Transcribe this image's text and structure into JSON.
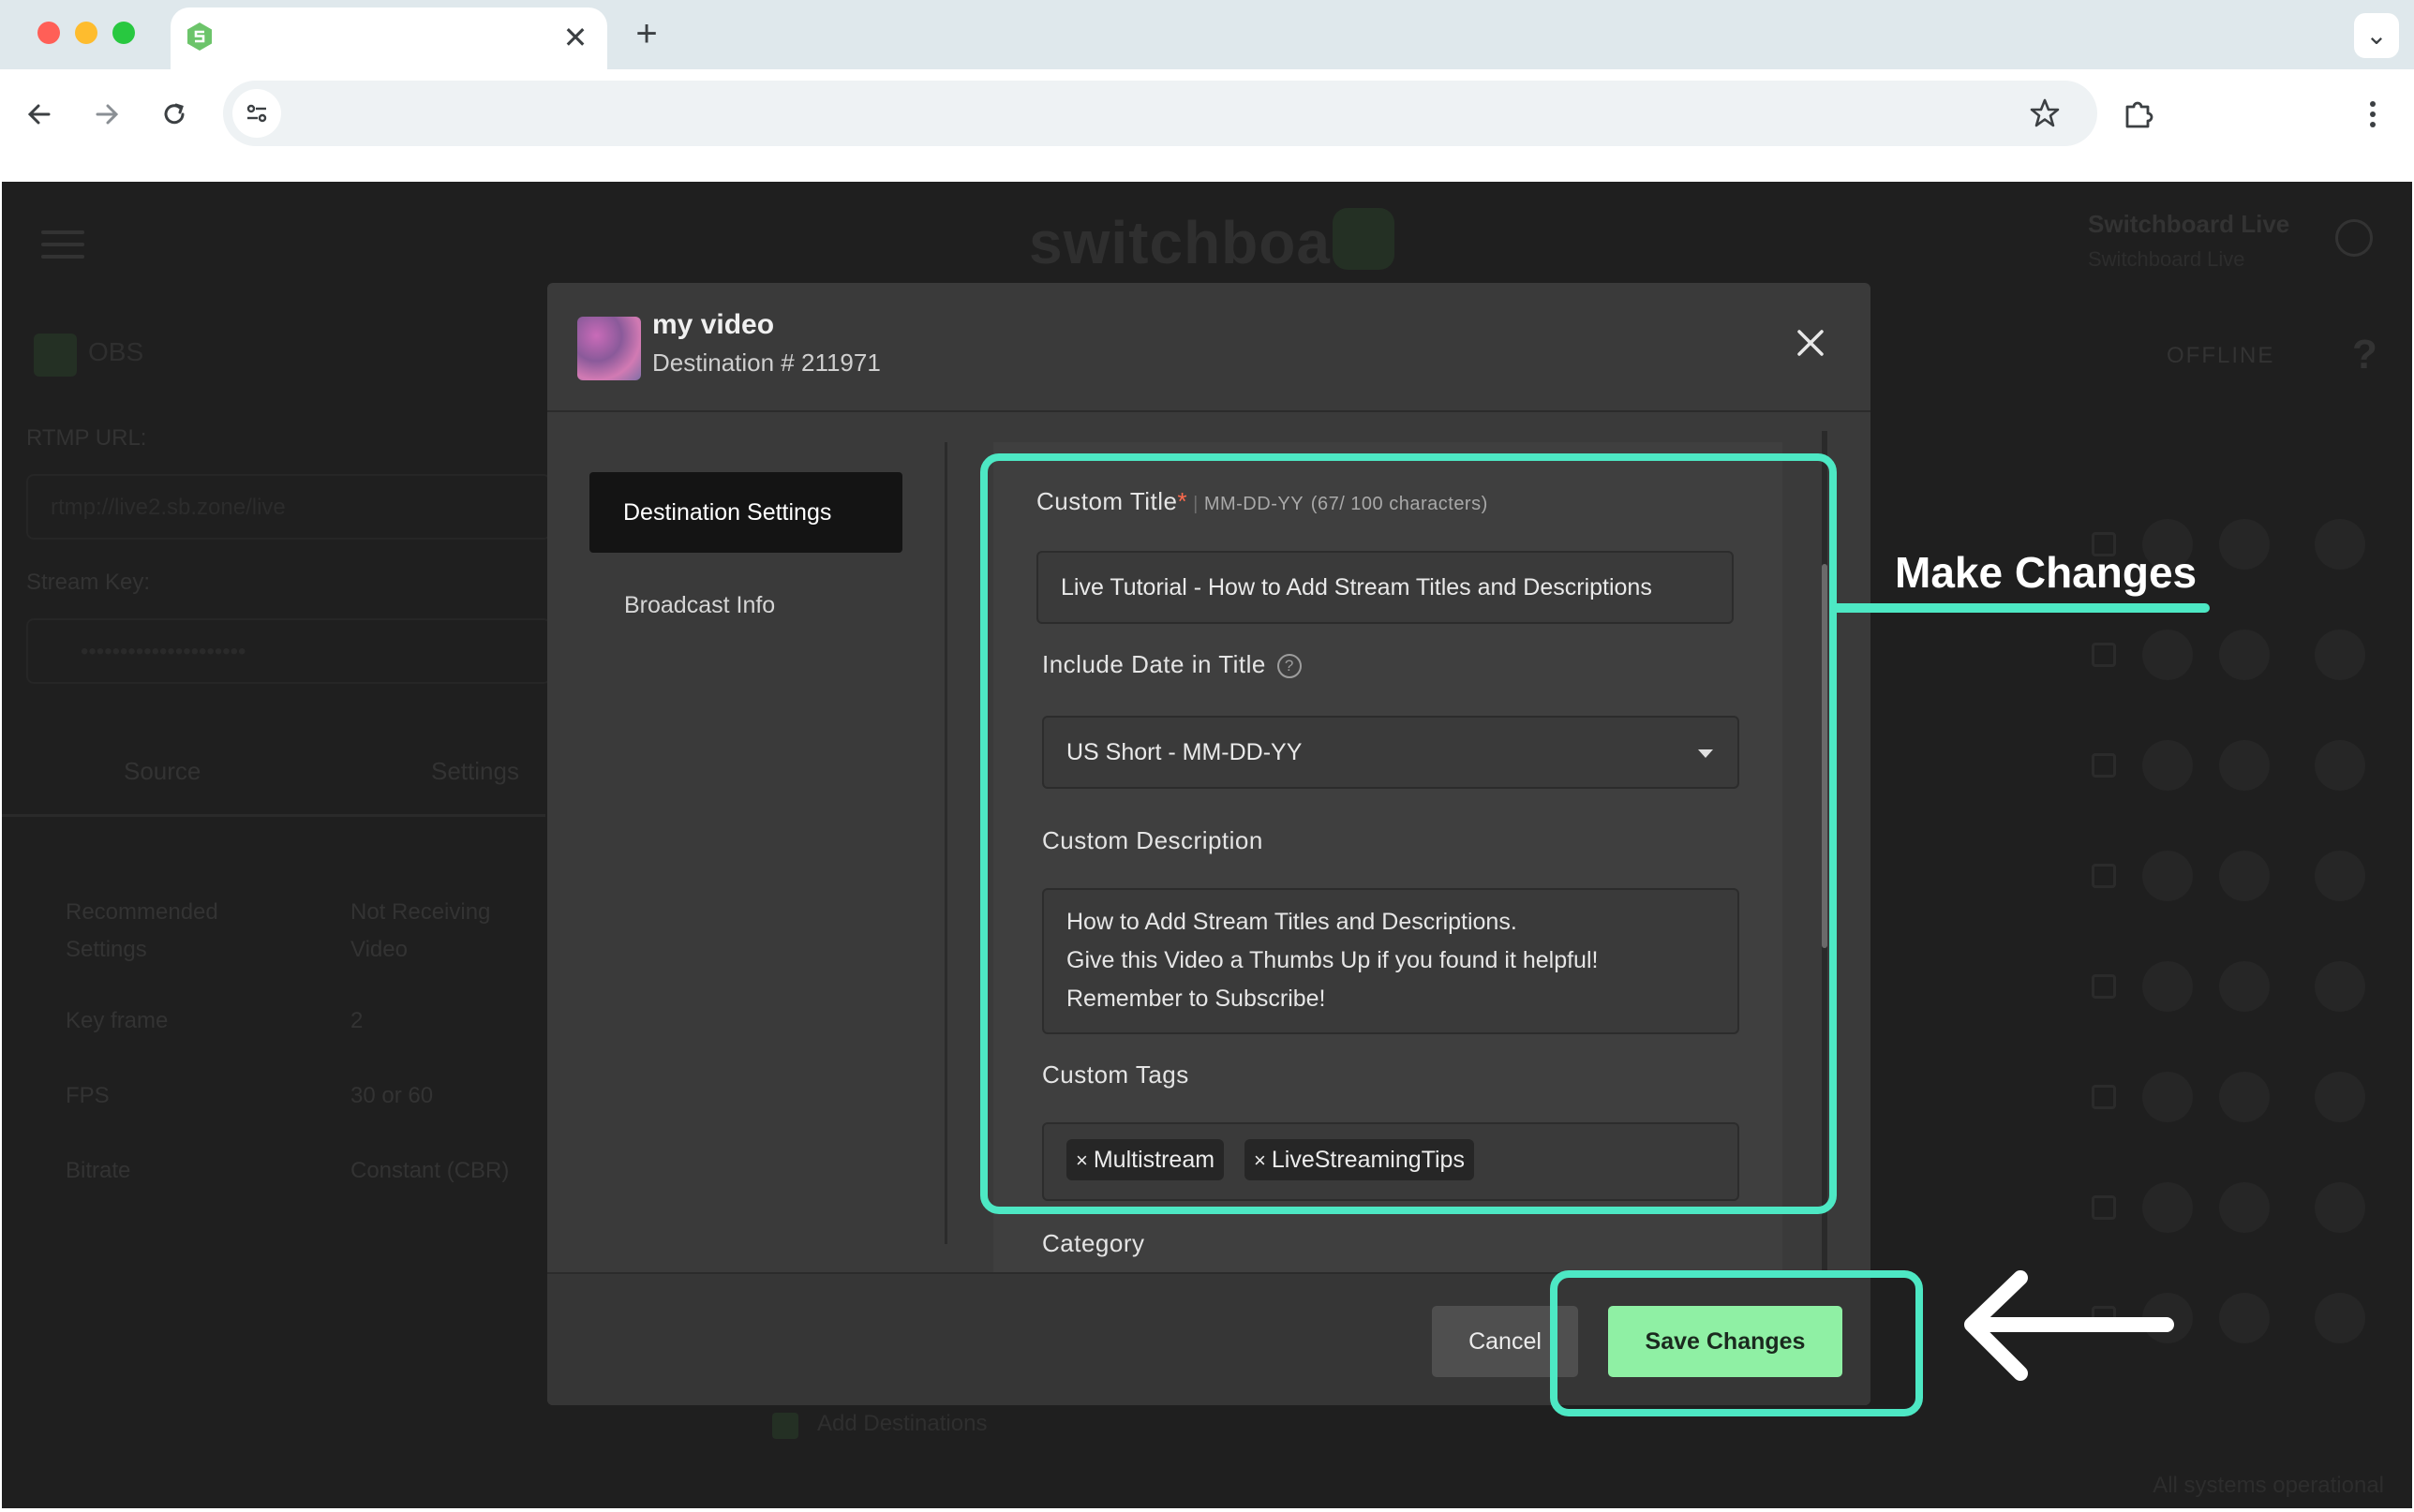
{
  "browser": {
    "tab_close": "✕",
    "new_tab": "+",
    "tab_search": "⌄"
  },
  "app": {
    "logo": "switchboard",
    "account_name": "Switchboard Live",
    "account_sub": "Switchboard Live",
    "source_name": "OBS",
    "status_offline": "OFFLINE",
    "rtmp_label": "RTMP URL:",
    "rtmp_value": "rtmp://live2.sb.zone/live",
    "stream_key_label": "Stream Key:",
    "stream_key_value": "•••••••••••••••••••••",
    "source_tabs": [
      "Source",
      "Settings"
    ],
    "settings_rows": [
      {
        "label": "Recommended Settings",
        "value": "Not Receiving Video"
      },
      {
        "label": "Key frame",
        "value": "2"
      },
      {
        "label": "FPS",
        "value": "30 or 60"
      },
      {
        "label": "Bitrate",
        "value": "Constant (CBR)"
      }
    ],
    "add_destinations": "Add Destinations",
    "system_status": "All systems operational"
  },
  "modal": {
    "title": "my video",
    "subtitle": "Destination # 211971",
    "sidebar": {
      "items": [
        {
          "label": "Destination Settings",
          "active": true
        },
        {
          "label": "Broadcast Info",
          "active": false
        }
      ]
    },
    "custom_title": {
      "label": "Custom Title",
      "required_mark": "*",
      "separator": "|",
      "format_hint": "MM-DD-YY",
      "char_count": "(67/ 100 characters)",
      "value": "Live Tutorial - How to Add Stream Titles and Descriptions"
    },
    "include_date": {
      "label": "Include Date in Title",
      "help": "?",
      "selected": "US Short - MM-DD-YY"
    },
    "custom_description": {
      "label": "Custom Description",
      "lines": [
        "How to Add Stream Titles and Descriptions.",
        "Give this Video a Thumbs Up if you found it helpful!",
        "Remember to Subscribe!"
      ]
    },
    "custom_tags": {
      "label": "Custom Tags",
      "remove_glyph": "×",
      "tags": [
        "Multistream",
        "LiveStreamingTips"
      ]
    },
    "category_label": "Category",
    "cancel_label": "Cancel",
    "save_label": "Save Changes"
  },
  "annotations": {
    "make_changes": "Make Changes"
  },
  "colors": {
    "highlight": "#4de8c4",
    "save_button": "#8ff0a4",
    "required": "#ff6a4d",
    "modal_bg": "#3a3a3a"
  }
}
